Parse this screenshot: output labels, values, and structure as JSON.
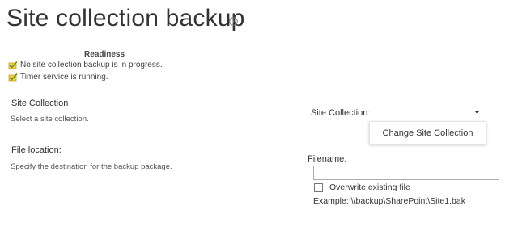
{
  "page": {
    "title": "Site collection backup",
    "info_icon": "info-icon"
  },
  "readiness": {
    "heading": "Readiness",
    "items": [
      {
        "icon": "checkmark-icon",
        "text": "No site collection backup is in progress."
      },
      {
        "icon": "checkmark-icon",
        "text": "Timer service is running."
      }
    ]
  },
  "site_collection_section": {
    "label": "Site Collection",
    "description": "Select a site collection.",
    "field_label": "Site Collection:",
    "dropdown_icon": "caret-down-icon",
    "menu_item": "Change Site Collection"
  },
  "file_location_section": {
    "label": "File location:",
    "description": "Specify the destination for the backup package.",
    "filename_label": "Filename:",
    "filename_value": "",
    "overwrite_label": "Overwrite existing file",
    "overwrite_checked": false,
    "example": "Example: \\\\backup\\SharePoint\\Site1.bak"
  },
  "colors": {
    "check_fill": "#e0b100",
    "check_tick": "#7a9a1f",
    "text": "#333333"
  }
}
